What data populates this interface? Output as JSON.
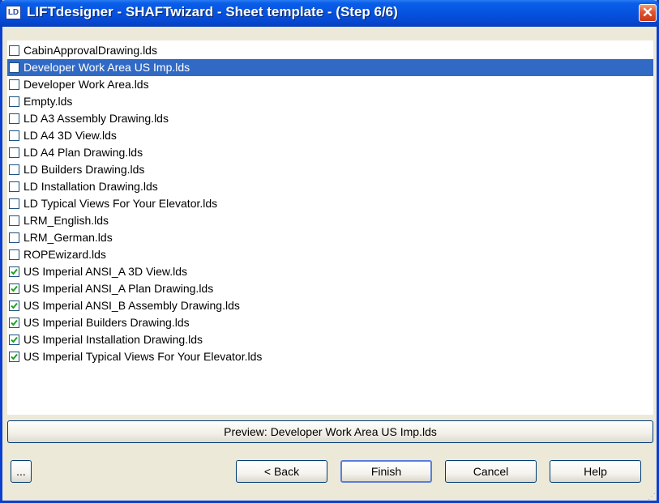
{
  "window": {
    "title": "LIFTdesigner - SHAFTwizard - Sheet template - (Step 6/6)",
    "app_icon_text": "LD",
    "close_symbol": "✕"
  },
  "templates": [
    {
      "label": "CabinApprovalDrawing.lds",
      "checked": false,
      "selected": false
    },
    {
      "label": "Developer Work Area US Imp.lds",
      "checked": false,
      "selected": true
    },
    {
      "label": "Developer Work Area.lds",
      "checked": false,
      "selected": false
    },
    {
      "label": "Empty.lds",
      "checked": false,
      "selected": false
    },
    {
      "label": "LD A3 Assembly Drawing.lds",
      "checked": false,
      "selected": false
    },
    {
      "label": "LD A4 3D View.lds",
      "checked": false,
      "selected": false
    },
    {
      "label": "LD A4 Plan Drawing.lds",
      "checked": false,
      "selected": false
    },
    {
      "label": "LD Builders Drawing.lds",
      "checked": false,
      "selected": false
    },
    {
      "label": "LD Installation Drawing.lds",
      "checked": false,
      "selected": false
    },
    {
      "label": "LD Typical Views For Your Elevator.lds",
      "checked": false,
      "selected": false
    },
    {
      "label": "LRM_English.lds",
      "checked": false,
      "selected": false
    },
    {
      "label": "LRM_German.lds",
      "checked": false,
      "selected": false
    },
    {
      "label": "ROPEwizard.lds",
      "checked": false,
      "selected": false
    },
    {
      "label": "US Imperial ANSI_A 3D View.lds",
      "checked": true,
      "selected": false
    },
    {
      "label": "US Imperial ANSI_A Plan Drawing.lds",
      "checked": true,
      "selected": false
    },
    {
      "label": "US  Imperial ANSI_B  Assembly Drawing.lds",
      "checked": true,
      "selected": false
    },
    {
      "label": "US Imperial Builders Drawing.lds",
      "checked": true,
      "selected": false
    },
    {
      "label": "US Imperial Installation Drawing.lds",
      "checked": true,
      "selected": false
    },
    {
      "label": "US Imperial Typical Views For Your Elevator.lds",
      "checked": true,
      "selected": false
    }
  ],
  "preview": {
    "label": "Preview: Developer Work Area US Imp.lds"
  },
  "buttons": {
    "more": "...",
    "back": "< Back",
    "finish": "Finish",
    "cancel": "Cancel",
    "help": "Help"
  },
  "colors": {
    "selection": "#316ac5",
    "titlebar": "#0654e1",
    "check_mark": "#21a121"
  }
}
